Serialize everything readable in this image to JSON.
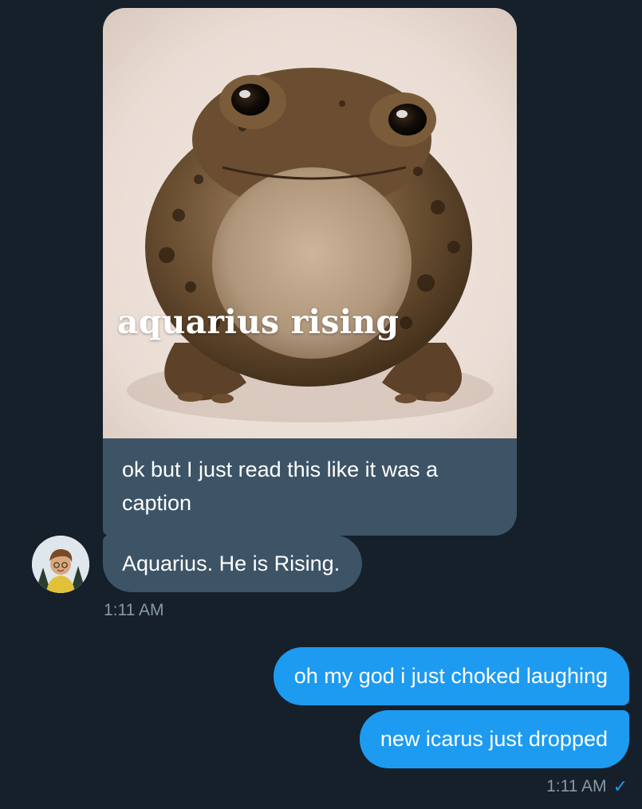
{
  "conversation": {
    "incoming": {
      "media": {
        "subject_icon": "toad-photo",
        "overlay_text": "aquarius rising"
      },
      "media_caption": "ok but I just read this like it was a caption",
      "message": "Aquarius. He is Rising.",
      "avatar_icon": "user-avatar",
      "timestamp": "1:11 AM"
    },
    "outgoing": {
      "messages": [
        "oh my god i just choked laughing",
        "new icarus just dropped"
      ],
      "timestamp": "1:11 AM",
      "read_icon": "check-icon"
    }
  },
  "colors": {
    "background": "#15202b",
    "incoming_bubble": "#3d5466",
    "outgoing_bubble": "#1d9bf0",
    "meta_text": "#8899a6"
  }
}
